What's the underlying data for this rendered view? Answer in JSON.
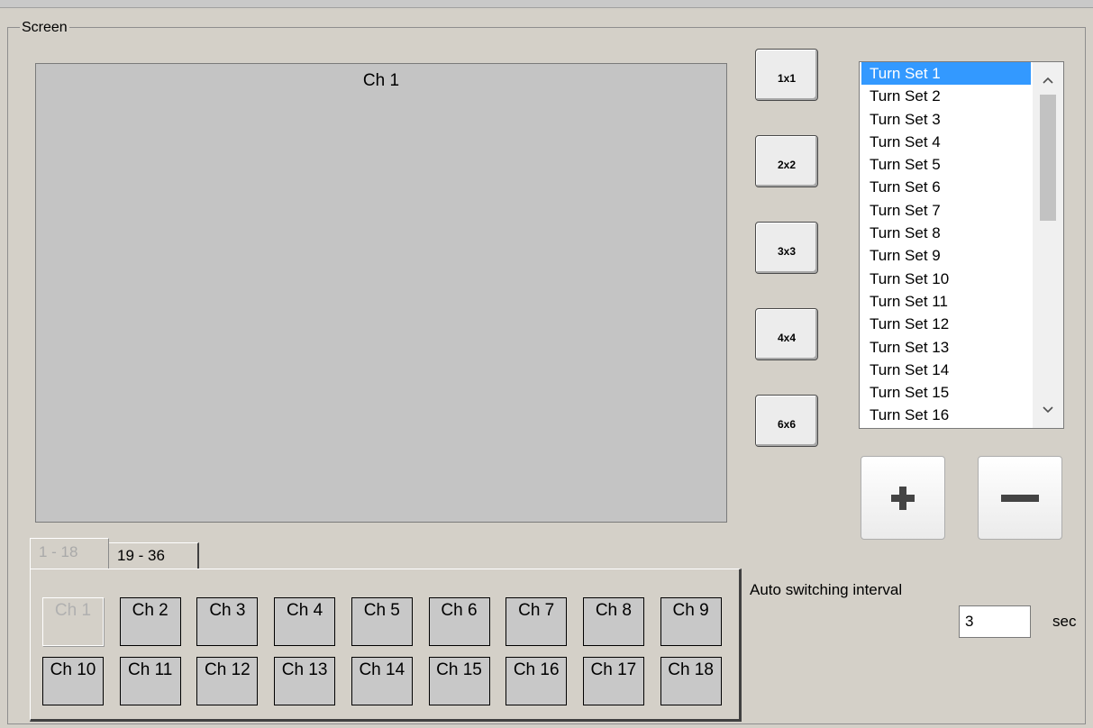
{
  "group": {
    "label": "Screen"
  },
  "preview": {
    "label": "Ch 1"
  },
  "layout_buttons": [
    "1x1",
    "2x2",
    "3x3",
    "4x4",
    "6x6"
  ],
  "turn_sets": {
    "items": [
      "Turn Set  1",
      "Turn Set  2",
      "Turn Set  3",
      "Turn Set  4",
      "Turn Set  5",
      "Turn Set  6",
      "Turn Set  7",
      "Turn Set  8",
      "Turn Set  9",
      "Turn Set  10",
      "Turn Set  11",
      "Turn Set  12",
      "Turn Set  13",
      "Turn Set  14",
      "Turn Set  15",
      "Turn Set  16"
    ],
    "selected_index": 0,
    "scroll_up": "^",
    "scroll_down": "v"
  },
  "add_button": {
    "icon": "plus-icon"
  },
  "remove_button": {
    "icon": "minus-icon"
  },
  "tabs": [
    {
      "label": "1 - 18",
      "active": true
    },
    {
      "label": "19 - 36",
      "active": false
    }
  ],
  "channels": [
    "Ch 1",
    "Ch 2",
    "Ch 3",
    "Ch 4",
    "Ch 5",
    "Ch 6",
    "Ch 7",
    "Ch 8",
    "Ch 9",
    "Ch 10",
    "Ch 11",
    "Ch 12",
    "Ch 13",
    "Ch 14",
    "Ch 15",
    "Ch 16",
    "Ch 17",
    "Ch 18"
  ],
  "disabled_channel_index": 0,
  "auto_switch": {
    "label": "Auto switching interval",
    "value": "3",
    "unit": "sec"
  },
  "colors": {
    "selection": "#3399ff",
    "preview_bg": "#c4c4c4",
    "window_bg": "#d4d0c8"
  }
}
